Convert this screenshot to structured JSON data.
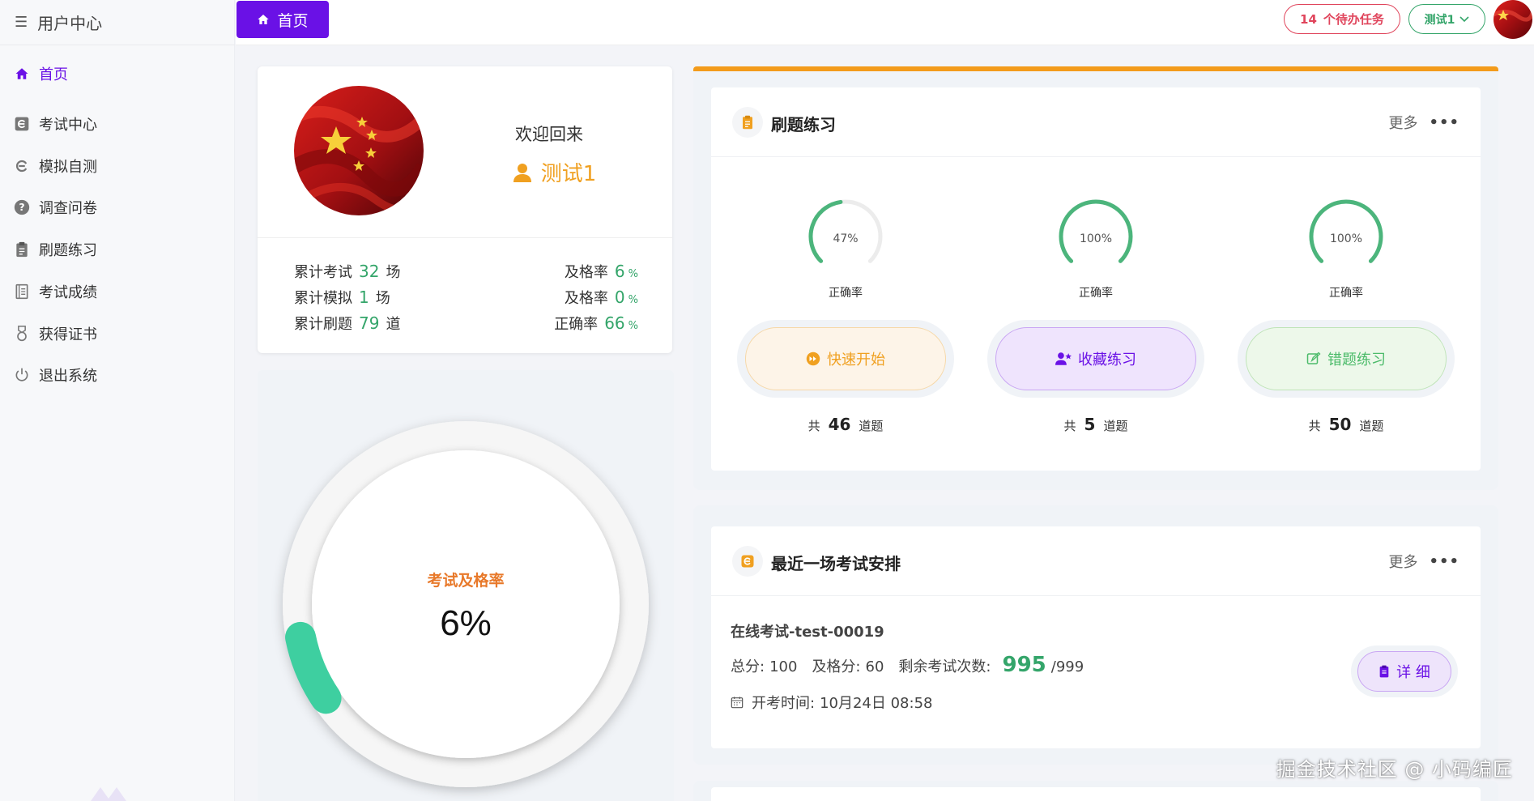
{
  "sidebar": {
    "title": "用户中心",
    "items": [
      {
        "label": "首页",
        "icon": "home-icon",
        "active": true
      },
      {
        "label": "考试中心",
        "icon": "exam-center-icon"
      },
      {
        "label": "模拟自测",
        "icon": "mock-test-icon"
      },
      {
        "label": "调查问卷",
        "icon": "question-icon"
      },
      {
        "label": "刷题练习",
        "icon": "clipboard-icon"
      },
      {
        "label": "考试成绩",
        "icon": "grade-book-icon"
      },
      {
        "label": "获得证书",
        "icon": "medal-icon"
      },
      {
        "label": "退出系统",
        "icon": "power-icon"
      }
    ]
  },
  "topbar": {
    "home_tab": "首页",
    "todo_count": "14",
    "todo_label": "个待办任务",
    "user_name": "测试1"
  },
  "profile": {
    "welcome": "欢迎回来",
    "username": "测试1",
    "stats": {
      "exam_label": "累计考试",
      "exam_count": "32",
      "exam_unit": "场",
      "exam_pass_label": "及格率",
      "exam_pass_rate": "6",
      "exam_pass_unit": "%",
      "mock_label": "累计模拟",
      "mock_count": "1",
      "mock_unit": "场",
      "mock_pass_label": "及格率",
      "mock_pass_rate": "0",
      "mock_pass_unit": "%",
      "practice_label": "累计刷题",
      "practice_count": "79",
      "practice_unit": "道",
      "practice_correct_label": "正确率",
      "practice_correct_rate": "66",
      "practice_correct_unit": "%"
    }
  },
  "pass_rate": {
    "title": "考试及格率",
    "value": "6%",
    "fraction": 0.06,
    "color": "#3ecfa0"
  },
  "practice": {
    "title": "刷题练习",
    "more": "更多",
    "modes": [
      {
        "gauge_text": "47%",
        "gauge_value": 0.47,
        "gauge_label": "正确率",
        "button": "快速开始",
        "total_prefix": "共",
        "total": "46",
        "total_suffix": "道题",
        "icon": "play-circle-icon",
        "color": "#f0a020"
      },
      {
        "gauge_text": "100%",
        "gauge_value": 1.0,
        "gauge_label": "正确率",
        "button": "收藏练习",
        "total_prefix": "共",
        "total": "5",
        "total_suffix": "道题",
        "icon": "user-star-icon",
        "color": "#6a11e6"
      },
      {
        "gauge_text": "100%",
        "gauge_value": 1.0,
        "gauge_label": "正确率",
        "button": "错题练习",
        "total_prefix": "共",
        "total": "50",
        "total_suffix": "道题",
        "icon": "edit-box-icon",
        "color": "#4cbb6a"
      }
    ]
  },
  "exam": {
    "title": "最近一场考试安排",
    "more": "更多",
    "name": "在线考试-test-00019",
    "total_label": "总分:",
    "total": "100",
    "pass_label": "及格分:",
    "pass": "60",
    "remaining_label": "剩余考试次数:",
    "remaining": "995",
    "remaining_max": "/999",
    "time_label": "开考时间:",
    "time": "10月24日 08:58",
    "detail_button": "详 细"
  },
  "watermark": "掘金技术社区 @ 小码编匠",
  "colors": {
    "accent": "#6a11e6",
    "green": "#34a56a",
    "orange": "#f0a020",
    "red": "#e0455c"
  }
}
